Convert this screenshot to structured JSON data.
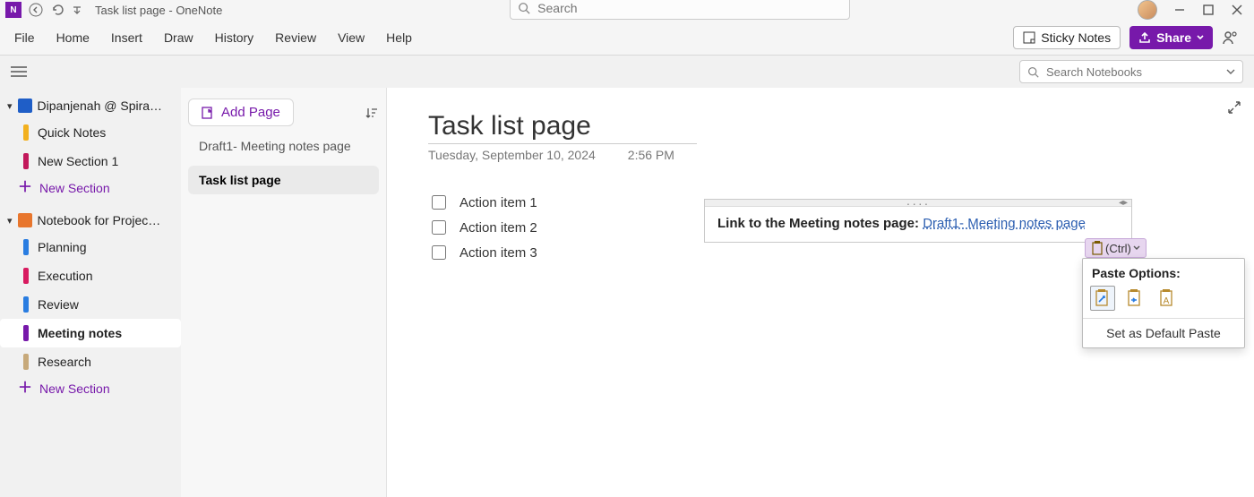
{
  "window": {
    "title": "Task list page  -  OneNote"
  },
  "search": {
    "placeholder": "Search"
  },
  "menus": [
    "File",
    "Home",
    "Insert",
    "Draw",
    "History",
    "Review",
    "View",
    "Help"
  ],
  "header_actions": {
    "sticky": "Sticky Notes",
    "share": "Share"
  },
  "notebook_search": {
    "placeholder": "Search Notebooks"
  },
  "notebooks": [
    {
      "name": "Dipanjenah @ Spiral...",
      "icon": "blue",
      "sections": [
        {
          "label": "Quick Notes",
          "color": "#f2b01e"
        },
        {
          "label": "New Section 1",
          "color": "#c2185b"
        }
      ],
      "new_section_label": "New Section"
    },
    {
      "name": "Notebook for Project A",
      "icon": "orange",
      "sections": [
        {
          "label": "Planning",
          "color": "#2a7de1"
        },
        {
          "label": "Execution",
          "color": "#d81b60"
        },
        {
          "label": "Review",
          "color": "#2a7de1"
        },
        {
          "label": "Meeting notes",
          "color": "#7719aa",
          "selected": true
        },
        {
          "label": "Research",
          "color": "#c7a97a"
        }
      ],
      "new_section_label": "New Section"
    }
  ],
  "pagelist": {
    "add_label": "Add Page",
    "pages": [
      {
        "label": "Draft1- Meeting notes page"
      },
      {
        "label": "Task list page",
        "selected": true
      }
    ]
  },
  "page": {
    "title": "Task list page",
    "date": "Tuesday, September 10, 2024",
    "time": "2:56 PM",
    "tasks": [
      "Action item 1",
      "Action item 2",
      "Action item 3"
    ]
  },
  "float_note": {
    "prefix": "Link to the Meeting notes page: ",
    "link_text": "Draft1- Meeting notes page"
  },
  "paste": {
    "ctrl_label": "(Ctrl)",
    "header": "Paste Options:",
    "set_default": "Set as Default Paste"
  }
}
